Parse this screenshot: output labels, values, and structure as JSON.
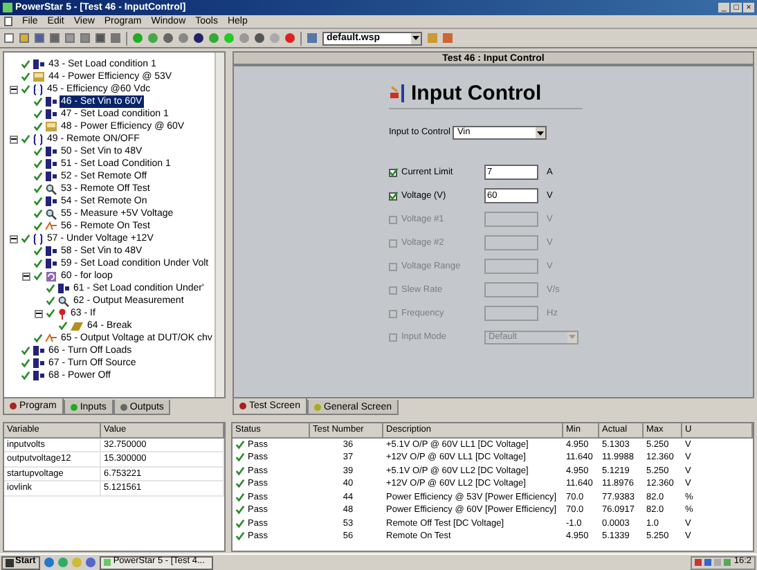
{
  "window": {
    "title": "PowerStar 5 - [Test 46 - InputControl]",
    "controls": [
      "_",
      "□",
      "×"
    ]
  },
  "menu": [
    "File",
    "Edit",
    "View",
    "Program",
    "Window",
    "Tools",
    "Help"
  ],
  "toolbar": {
    "workspace": "default.wsp"
  },
  "tree": {
    "items": [
      {
        "label": "43 - Set Load condition 1",
        "kind": "action",
        "checked": true,
        "selected": false
      },
      {
        "label": "44 - Power Efficiency @ 53V",
        "kind": "measure",
        "checked": true,
        "selected": false
      },
      {
        "label": "45 - Efficiency @60 Vdc",
        "kind": "group",
        "checked": true,
        "selected": false,
        "expanded": true,
        "children": [
          {
            "label": "46 - Set Vin to 60V",
            "kind": "action",
            "checked": true,
            "selected": true
          },
          {
            "label": "47 - Set Load condition 1",
            "kind": "action",
            "checked": true,
            "selected": false
          },
          {
            "label": "48 - Power Efficiency @ 60V",
            "kind": "measure",
            "checked": true,
            "selected": false
          }
        ]
      },
      {
        "label": "49 - Remote ON/OFF",
        "kind": "group",
        "checked": true,
        "selected": false,
        "expanded": true,
        "children": [
          {
            "label": "50 - Set Vin to 48V",
            "kind": "action",
            "checked": true,
            "selected": false
          },
          {
            "label": "51 - Set Load Condition 1",
            "kind": "action",
            "checked": true,
            "selected": false
          },
          {
            "label": "52 - Set Remote Off",
            "kind": "action",
            "checked": true,
            "selected": false
          },
          {
            "label": "53 - Remote Off Test",
            "kind": "test",
            "checked": true,
            "selected": false
          },
          {
            "label": "54 - Set Remote On",
            "kind": "action",
            "checked": true,
            "selected": false
          },
          {
            "label": "55 - Measure +5V Voltage",
            "kind": "test",
            "checked": true,
            "selected": false
          },
          {
            "label": "56 - Remote On Test",
            "kind": "math",
            "checked": true,
            "selected": false
          }
        ]
      },
      {
        "label": "57 - Under Voltage +12V",
        "kind": "group",
        "checked": true,
        "selected": false,
        "expanded": true,
        "children": [
          {
            "label": "58 - Set Vin to 48V",
            "kind": "action",
            "checked": true,
            "selected": false
          },
          {
            "label": "59 - Set Load condition Under Volt",
            "kind": "action",
            "checked": true,
            "selected": false
          },
          {
            "label": "60 - for loop",
            "kind": "loop",
            "checked": true,
            "selected": false,
            "expanded": true,
            "children": [
              {
                "label": "61 - Set Load condition Under'",
                "kind": "action",
                "checked": true,
                "selected": false
              },
              {
                "label": "62 - Output Measurement",
                "kind": "test",
                "checked": true,
                "selected": false
              },
              {
                "label": "63 - If",
                "kind": "condition",
                "checked": true,
                "selected": false,
                "expanded": true,
                "children": [
                  {
                    "label": "64 - Break",
                    "kind": "break",
                    "checked": true,
                    "selected": false
                  }
                ]
              }
            ]
          },
          {
            "label": "65 - Output Voltage at DUT/OK chv",
            "kind": "math",
            "checked": true,
            "selected": false
          }
        ]
      },
      {
        "label": "66 - Turn Off Loads",
        "kind": "action",
        "checked": true,
        "selected": false
      },
      {
        "label": "67 - Turn Off Source",
        "kind": "action",
        "checked": true,
        "selected": false
      },
      {
        "label": "68 - Power Off",
        "kind": "action",
        "checked": true,
        "selected": false
      }
    ]
  },
  "left_tabs": [
    {
      "label": "Program",
      "selected": true
    },
    {
      "label": "Inputs",
      "selected": false
    },
    {
      "label": "Outputs",
      "selected": false
    }
  ],
  "panel": {
    "header": "Test 46 : Input Control",
    "title": "Input Control",
    "input_label": "Input to Control",
    "input_value": "Vin",
    "rows": [
      {
        "kind": "field",
        "label": "Current Limit",
        "value": "7",
        "unit": "A",
        "checked": true,
        "disabled": false
      },
      {
        "kind": "field",
        "label": "Voltage (V)",
        "value": "60",
        "unit": "V",
        "checked": true,
        "disabled": false
      },
      {
        "kind": "field",
        "label": "Voltage #1",
        "unit": "V",
        "checked": false,
        "disabled": true
      },
      {
        "kind": "field",
        "label": "Voltage #2",
        "unit": "V",
        "checked": false,
        "disabled": true
      },
      {
        "kind": "field",
        "label": "Voltage Range",
        "unit": "V",
        "checked": false,
        "disabled": true
      },
      {
        "kind": "field",
        "label": "Slew Rate",
        "unit": "V/s",
        "checked": false,
        "disabled": true
      },
      {
        "kind": "field",
        "label": "Frequency",
        "unit": "Hz",
        "checked": false,
        "disabled": true
      },
      {
        "kind": "select",
        "label": "Input Mode",
        "value": "Default",
        "checked": false,
        "disabled": true
      }
    ]
  },
  "right_tabs": [
    {
      "label": "Test Screen",
      "selected": true
    },
    {
      "label": "General Screen",
      "selected": false
    }
  ],
  "variables": {
    "columns": [
      "Variable",
      "Value"
    ],
    "rows": [
      [
        "inputvolts",
        "32.750000"
      ],
      [
        "outputvoltage12",
        "15.300000"
      ],
      [
        "startupvoltage",
        "6.753221"
      ],
      [
        "iovlink",
        "5.121561"
      ]
    ]
  },
  "results": {
    "columns": [
      "Status",
      "Test Number",
      "Description",
      "Min",
      "Actual",
      "Max",
      "U"
    ],
    "rows": [
      [
        "Pass",
        "36",
        "+5.1V O/P @ 60V LL1 [DC Voltage]",
        "4.950",
        "5.1303",
        "5.250",
        "V"
      ],
      [
        "Pass",
        "37",
        "+12V O/P @ 60V LL1 [DC Voltage]",
        "11.640",
        "11.9988",
        "12.360",
        "V"
      ],
      [
        "Pass",
        "39",
        "+5.1V O/P @ 60V LL2 [DC Voltage]",
        "4.950",
        "5.1219",
        "5.250",
        "V"
      ],
      [
        "Pass",
        "40",
        "+12V O/P @ 60V LL2 [DC Voltage]",
        "11.640",
        "11.8976",
        "12.360",
        "V"
      ],
      [
        "Pass",
        "44",
        "Power Efficiency @ 53V [Power Efficiency]",
        "70.0",
        "77.9383",
        "82.0",
        "%"
      ],
      [
        "Pass",
        "48",
        "Power Efficiency @ 60V [Power Efficiency]",
        "70.0",
        "76.0917",
        "82.0",
        "%"
      ],
      [
        "Pass",
        "53",
        "Remote Off Test [DC Voltage]",
        "-1.0",
        "0.0003",
        "1.0",
        "V"
      ],
      [
        "Pass",
        "56",
        "Remote On Test",
        "4.950",
        "5.1339",
        "5.250",
        "V"
      ]
    ]
  },
  "taskbar": {
    "start": "Start",
    "task": "PowerStar 5 - [Test 4...",
    "clock": "16:2"
  }
}
